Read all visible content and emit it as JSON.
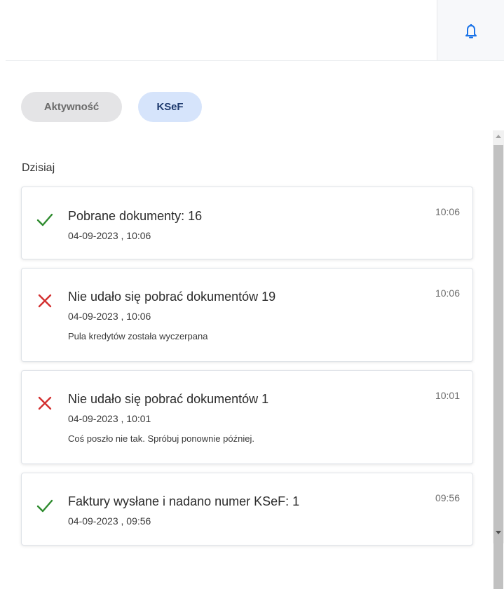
{
  "colors": {
    "accent": "#1a73e8",
    "success": "#2e8b2e",
    "error": "#d32f2f",
    "tab_active_bg": "#d6e4fb",
    "tab_inactive_bg": "#e4e4e6"
  },
  "header": {
    "bell_icon": "bell-icon"
  },
  "tabs": [
    {
      "label": "Aktywność",
      "active": false
    },
    {
      "label": "KSeF",
      "active": true
    }
  ],
  "section": {
    "title": "Dzisiaj"
  },
  "notifications": [
    {
      "status": "success",
      "icon": "check-icon",
      "title": "Pobrane dokumenty: 16",
      "date": "04-09-2023 , 10:06",
      "message": "",
      "time": "10:06"
    },
    {
      "status": "error",
      "icon": "cross-icon",
      "title": "Nie udało się pobrać dokumentów 19",
      "date": "04-09-2023 , 10:06",
      "message": "Pula kredytów została wyczerpana",
      "time": "10:06"
    },
    {
      "status": "error",
      "icon": "cross-icon",
      "title": "Nie udało się pobrać dokumentów 1",
      "date": "04-09-2023 , 10:01",
      "message": "Coś poszło nie tak. Spróbuj ponownie później.",
      "time": "10:01"
    },
    {
      "status": "success",
      "icon": "check-icon",
      "title": "Faktury wysłane i nadano numer KSeF: 1",
      "date": "04-09-2023 , 09:56",
      "message": "",
      "time": "09:56"
    }
  ]
}
